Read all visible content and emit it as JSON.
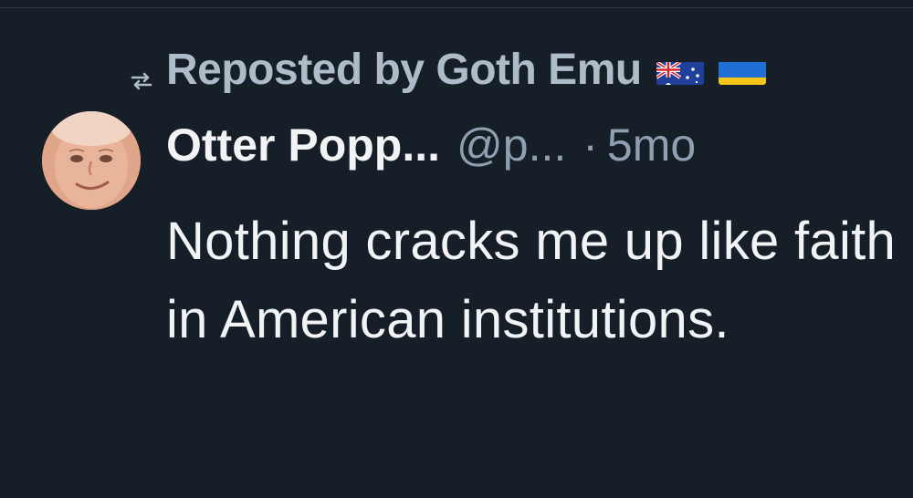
{
  "repost": {
    "icon": "repost-icon",
    "label": "Reposted by Goth Emu",
    "flags": [
      "australia-flag",
      "ukraine-flag"
    ]
  },
  "post": {
    "author_display_name": "Otter Popp...",
    "author_handle": "@p...",
    "separator": "·",
    "time_ago": "5mo",
    "text": "Nothing cracks me up like faith in American institutions."
  },
  "colors": {
    "background": "#161e27",
    "primary_text": "#f1f3f5",
    "secondary_text": "#8f9fb0",
    "repost_text": "#aebbc9"
  }
}
